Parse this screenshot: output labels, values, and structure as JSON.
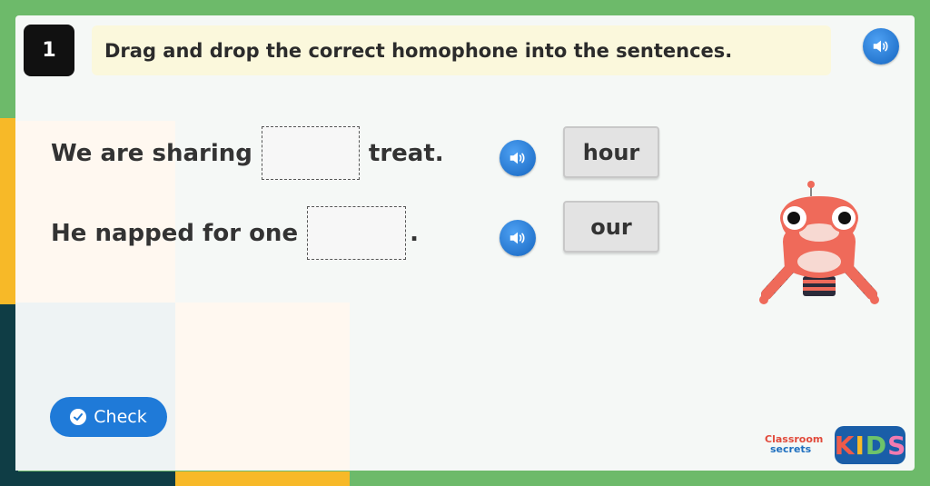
{
  "question": {
    "number": "1",
    "instruction": "Drag and drop the correct homophone into the sentences."
  },
  "sentences": [
    {
      "before": "We are sharing",
      "after": "treat."
    },
    {
      "before": "He napped for one",
      "after": "."
    }
  ],
  "word_tiles": [
    "hour",
    "our"
  ],
  "check_button": {
    "label": "Check",
    "icon": "check-circle-icon"
  },
  "icons": {
    "audio": "speaker-icon"
  },
  "logo": {
    "classroom_line1": "Classroom",
    "classroom_line2": "secrets",
    "kids_letters": [
      "K",
      "I",
      "D",
      "S"
    ]
  },
  "colors": {
    "background": "#6dba6a",
    "audio_blue": "#1f7ad8",
    "check_blue": "#1f7ad8",
    "instruction_bg": "#fbf8dc",
    "kids_logo_bg": "#1a5ea8",
    "mascot_body": "#ef6a5a"
  }
}
